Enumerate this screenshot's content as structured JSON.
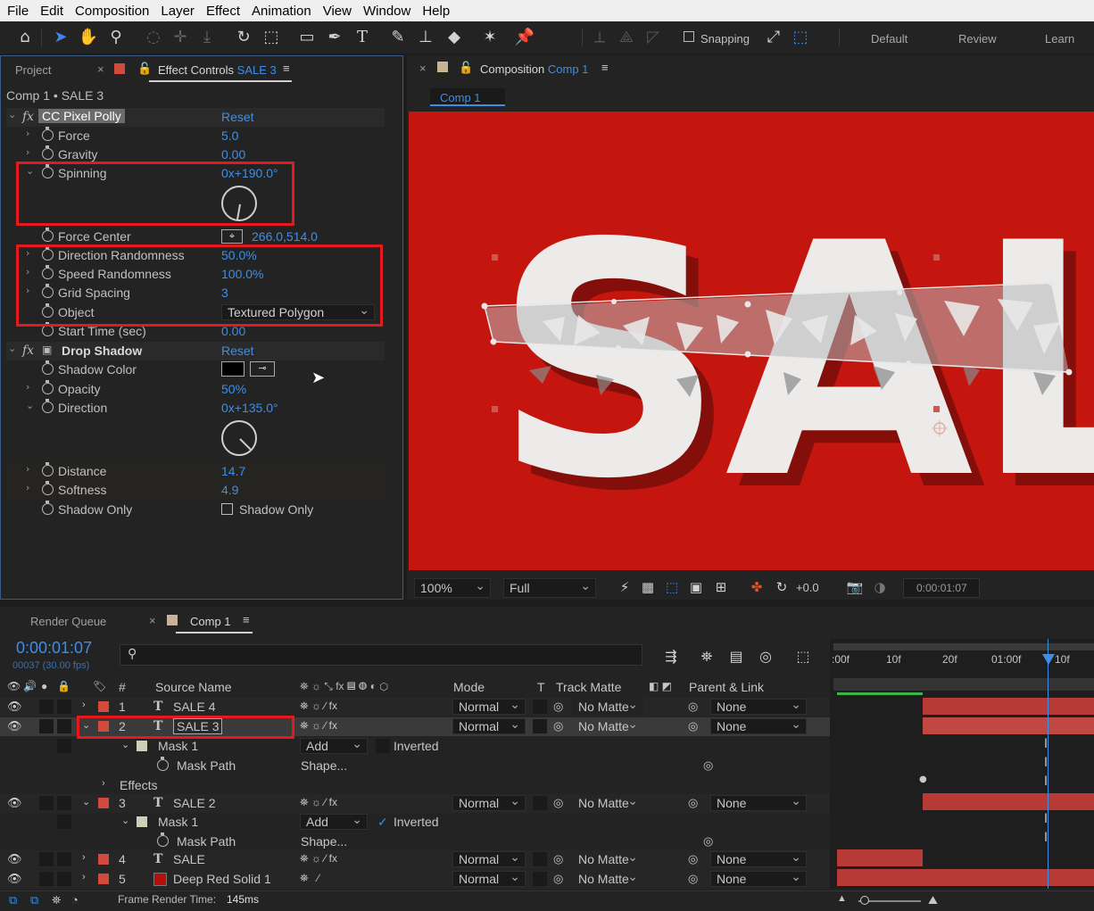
{
  "menu": [
    "File",
    "Edit",
    "Composition",
    "Layer",
    "Effect",
    "Animation",
    "View",
    "Window",
    "Help"
  ],
  "toolbar": {
    "snapping_label": "Snapping",
    "workspaces": [
      "Default",
      "Review",
      "Learn"
    ]
  },
  "colors": {
    "accent": "#3d8ee8",
    "highlight": "#e3191e",
    "comp_bg": "#c4150e",
    "label_red": "#d24a3c"
  },
  "left_panel": {
    "tab_project": "Project",
    "tab_effect_controls": "Effect Controls",
    "tab_effect_layer": "SALE 3",
    "breadcrumb": "Comp 1 • SALE 3",
    "effect1": {
      "fx": "fx",
      "name": "CC Pixel Polly",
      "reset": "Reset",
      "props": {
        "force": {
          "label": "Force",
          "value": "5.0"
        },
        "gravity": {
          "label": "Gravity",
          "value": "0.00"
        },
        "spinning": {
          "label": "Spinning",
          "value": "0x+190.0°"
        },
        "force_center": {
          "label": "Force Center",
          "value": "266.0,514.0"
        },
        "direction_randomness": {
          "label": "Direction Randomness",
          "value": "50.0%"
        },
        "speed_randomness": {
          "label": "Speed Randomness",
          "value": "100.0%"
        },
        "grid_spacing": {
          "label": "Grid Spacing",
          "value": "3"
        },
        "object": {
          "label": "Object",
          "value": "Textured Polygon"
        },
        "start_time": {
          "label": "Start Time (sec)",
          "value": "0.00"
        }
      }
    },
    "effect2": {
      "fx": "fx",
      "name": "Drop Shadow",
      "reset": "Reset",
      "props": {
        "shadow_color": {
          "label": "Shadow Color",
          "value": "#000000"
        },
        "opacity": {
          "label": "Opacity",
          "value": "50%"
        },
        "direction": {
          "label": "Direction",
          "value": "0x+135.0°"
        },
        "distance": {
          "label": "Distance",
          "value": "14.7"
        },
        "softness": {
          "label": "Softness",
          "value": "4.9"
        },
        "shadow_only": {
          "label": "Shadow Only",
          "value": "Shadow Only"
        }
      }
    }
  },
  "comp_panel": {
    "tab_label": "Composition",
    "tab_comp": "Comp 1",
    "sub_tab": "Comp 1",
    "viewer_text": "SAL",
    "zoom": "100%",
    "resolution": "Full",
    "exposure": "+0.0",
    "timecode": "0:00:01:07"
  },
  "timeline": {
    "tab_render_queue": "Render Queue",
    "tab_comp": "Comp 1",
    "current_time": "0:00:01:07",
    "frame_info": "00037 (30.00 fps)",
    "search_placeholder": "",
    "headers": {
      "num": "#",
      "source": "Source Name",
      "mode": "Mode",
      "t": "T",
      "track_matte": "Track Matte",
      "parent": "Parent & Link"
    },
    "ruler": [
      ":00f",
      "10f",
      "20f",
      "01:00f",
      "10f"
    ],
    "mask_name": "Mask 1",
    "mask_mode": "Add",
    "inverted": "Inverted",
    "mask_path": "Mask Path",
    "shape": "Shape...",
    "effects": "Effects",
    "mode_normal": "Normal",
    "matte_none": "No Matte",
    "parent_none": "None",
    "layers": [
      {
        "num": "1",
        "type": "T",
        "name": "SALE 4"
      },
      {
        "num": "2",
        "type": "T",
        "name": "SALE 3"
      },
      {
        "num": "3",
        "type": "T",
        "name": "SALE 2"
      },
      {
        "num": "4",
        "type": "T",
        "name": "SALE"
      },
      {
        "num": "5",
        "type": "solid",
        "name": "Deep Red Solid 1"
      }
    ],
    "footer_label": "Frame Render Time:",
    "footer_value": "145ms"
  }
}
